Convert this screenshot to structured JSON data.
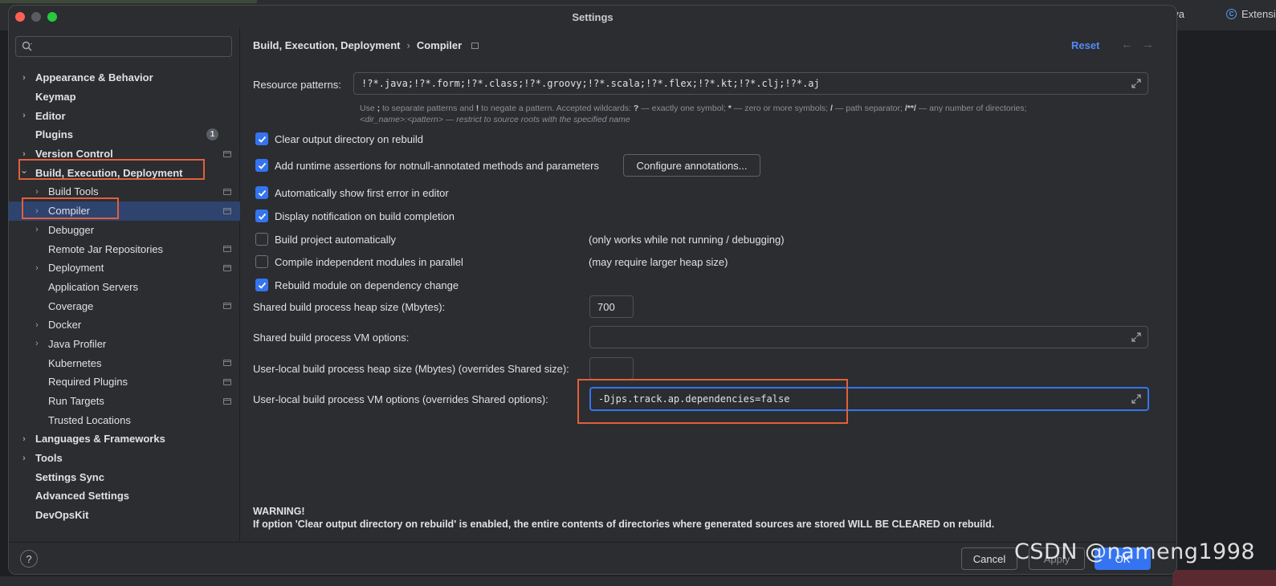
{
  "window": {
    "title": "Settings"
  },
  "background": {
    "tab_java": "ava",
    "tab_extensions": "Extensi"
  },
  "sidebar": {
    "items": [
      {
        "label": "Appearance & Behavior",
        "level": 0,
        "chevron": "right",
        "bold": true
      },
      {
        "label": "Keymap",
        "level": 0,
        "bold": true
      },
      {
        "label": "Editor",
        "level": 0,
        "chevron": "right",
        "bold": true
      },
      {
        "label": "Plugins",
        "level": 0,
        "bold": true,
        "badge": "1"
      },
      {
        "label": "Version Control",
        "level": 0,
        "chevron": "right",
        "bold": true,
        "gear": true
      },
      {
        "label": "Build, Execution, Deployment",
        "level": 0,
        "chevron": "down",
        "bold": true
      },
      {
        "label": "Build Tools",
        "level": 1,
        "chevron": "right",
        "gear": true
      },
      {
        "label": "Compiler",
        "level": 1,
        "chevron": "right",
        "gear": true,
        "selected": true
      },
      {
        "label": "Debugger",
        "level": 1,
        "chevron": "right"
      },
      {
        "label": "Remote Jar Repositories",
        "level": 1,
        "gear": true
      },
      {
        "label": "Deployment",
        "level": 1,
        "chevron": "right",
        "gear": true
      },
      {
        "label": "Application Servers",
        "level": 1
      },
      {
        "label": "Coverage",
        "level": 1,
        "gear": true
      },
      {
        "label": "Docker",
        "level": 1,
        "chevron": "right"
      },
      {
        "label": "Java Profiler",
        "level": 1,
        "chevron": "right"
      },
      {
        "label": "Kubernetes",
        "level": 1,
        "gear": true
      },
      {
        "label": "Required Plugins",
        "level": 1,
        "gear": true
      },
      {
        "label": "Run Targets",
        "level": 1,
        "gear": true
      },
      {
        "label": "Trusted Locations",
        "level": 1
      },
      {
        "label": "Languages & Frameworks",
        "level": 0,
        "chevron": "right",
        "bold": true
      },
      {
        "label": "Tools",
        "level": 0,
        "chevron": "right",
        "bold": true
      },
      {
        "label": "Settings Sync",
        "level": 0,
        "bold": true
      },
      {
        "label": "Advanced Settings",
        "level": 0,
        "bold": true
      },
      {
        "label": "DevOpsKit",
        "level": 0,
        "bold": true
      }
    ]
  },
  "header": {
    "crumb1": "Build, Execution, Deployment",
    "crumb_sep": "›",
    "crumb2": "Compiler",
    "reset": "Reset",
    "back": "←",
    "forward": "→"
  },
  "form": {
    "resource_patterns_label": "Resource patterns:",
    "resource_patterns_value": "!?*.java;!?*.form;!?*.class;!?*.groovy;!?*.scala;!?*.flex;!?*.kt;!?*.clj;!?*.aj",
    "hint_line1_a": "Use ",
    "hint_line1_b": ";",
    "hint_line1_c": " to separate patterns and ",
    "hint_line1_d": "!",
    "hint_line1_e": " to negate a pattern. Accepted wildcards: ",
    "hint_line1_f": "?",
    "hint_line1_g": " — exactly one symbol; ",
    "hint_line1_h": "*",
    "hint_line1_i": " — zero or more symbols; ",
    "hint_line1_j": "/",
    "hint_line1_k": " — path separator; ",
    "hint_line1_l": "/**/",
    "hint_line1_m": " — any number of directories;",
    "hint_line2": "<dir_name>:<pattern> — restrict to source roots with the specified name",
    "checkboxes": [
      {
        "label": "Clear output directory on rebuild",
        "checked": true
      },
      {
        "label": "Add runtime assertions for notnull-annotated methods and parameters",
        "checked": true
      },
      {
        "label": "Automatically show first error in editor",
        "checked": true
      },
      {
        "label": "Display notification on build completion",
        "checked": true
      },
      {
        "label": "Build project automatically",
        "checked": false,
        "note": "(only works while not running / debugging)"
      },
      {
        "label": "Compile independent modules in parallel",
        "checked": false,
        "note": "(may require larger heap size)"
      },
      {
        "label": "Rebuild module on dependency change",
        "checked": true
      }
    ],
    "configure_annotations": "Configure annotations...",
    "heap_label": "Shared build process heap size (Mbytes):",
    "heap_value": "700",
    "vm_label": "Shared build process VM options:",
    "vm_value": "",
    "user_heap_label": "User-local build process heap size (Mbytes) (overrides Shared size):",
    "user_heap_value": "",
    "user_vm_label": "User-local build process VM options (overrides Shared options):",
    "user_vm_value": "-Djps.track.ap.dependencies=false"
  },
  "warning": {
    "title": "WARNING!",
    "text": "If option 'Clear output directory on rebuild' is enabled, the entire contents of directories where generated sources are stored WILL BE CLEARED on rebuild."
  },
  "footer": {
    "help": "?",
    "cancel": "Cancel",
    "apply": "Apply",
    "ok": "OK"
  },
  "watermark": "CSDN @nameng1998",
  "colors": {
    "accent": "#3574f0",
    "highlight": "#e2603a",
    "selection": "#2e436e"
  }
}
